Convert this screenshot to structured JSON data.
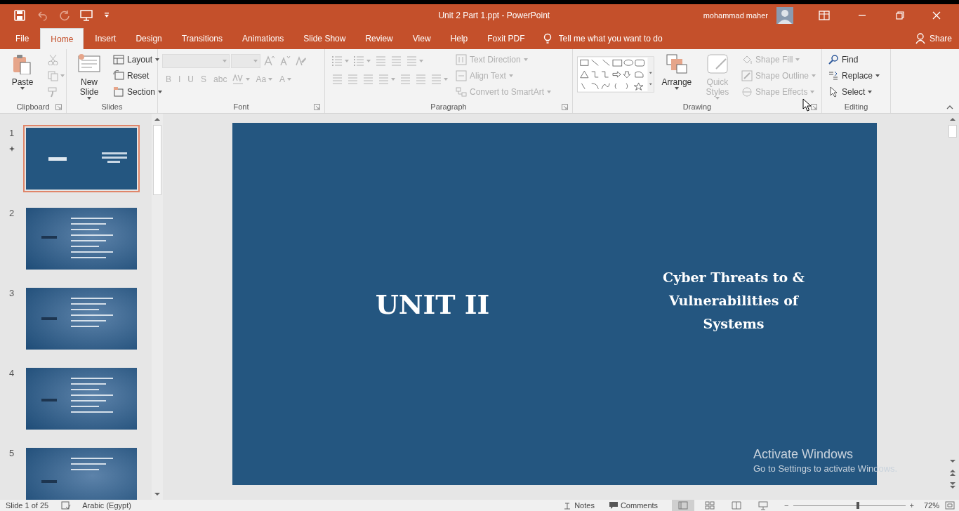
{
  "window": {
    "title": "Unit 2 Part 1.ppt - PowerPoint",
    "user": "mohammad maher"
  },
  "tabs": [
    {
      "label": "File",
      "selected": false
    },
    {
      "label": "Home",
      "selected": true
    },
    {
      "label": "Insert",
      "selected": false
    },
    {
      "label": "Design",
      "selected": false
    },
    {
      "label": "Transitions",
      "selected": false
    },
    {
      "label": "Animations",
      "selected": false
    },
    {
      "label": "Slide Show",
      "selected": false
    },
    {
      "label": "Review",
      "selected": false
    },
    {
      "label": "View",
      "selected": false
    },
    {
      "label": "Help",
      "selected": false
    },
    {
      "label": "Foxit PDF",
      "selected": false
    }
  ],
  "tell_me": {
    "placeholder": "Tell me what you want to do"
  },
  "share": {
    "label": "Share"
  },
  "ribbon": [
    {
      "label": "Clipboard",
      "launcher": true,
      "sections": [
        {
          "kind": "stack",
          "items": [
            {
              "kind": "large",
              "label": "Paste",
              "disabled": false,
              "menu": true
            }
          ]
        },
        {
          "kind": "stack",
          "items": [
            {
              "kind": "icon",
              "disabled": true,
              "menu": false
            },
            {
              "kind": "icon",
              "disabled": true,
              "menu": true
            },
            {
              "kind": "icon",
              "disabled": true,
              "menu": false
            }
          ]
        }
      ]
    },
    {
      "label": "Slides",
      "launcher": false,
      "sections": [
        {
          "kind": "stack",
          "items": [
            {
              "kind": "large",
              "label": "New Slide",
              "disabled": false,
              "menu": true
            }
          ]
        },
        {
          "kind": "stack",
          "items": [
            {
              "kind": "small",
              "label": "Layout",
              "disabled": false,
              "menu": true
            },
            {
              "kind": "small",
              "label": "Reset",
              "disabled": false,
              "menu": false
            },
            {
              "kind": "small",
              "label": "Section",
              "disabled": false,
              "menu": true
            }
          ]
        }
      ]
    },
    {
      "label": "Font",
      "launcher": true,
      "sections": [
        {
          "kind": "grid",
          "rows": [
            [
              {
                "kind": "font_field",
                "disabled": true
              },
              {
                "kind": "size_field",
                "disabled": true
              },
              {
                "kind": "icon",
                "disabled": true,
                "menu": false
              },
              {
                "kind": "icon",
                "disabled": true,
                "menu": false
              },
              {
                "kind": "icon",
                "disabled": true,
                "menu": false
              }
            ],
            [
              {
                "kind": "glyph",
                "label": "B",
                "disabled": true,
                "menu": false
              },
              {
                "kind": "glyph",
                "label": "I",
                "disabled": true,
                "menu": false
              },
              {
                "kind": "glyph",
                "label": "U",
                "disabled": true,
                "menu": false
              },
              {
                "kind": "glyph",
                "label": "S",
                "disabled": true,
                "menu": false
              },
              {
                "kind": "glyph",
                "label": "abc",
                "disabled": true,
                "menu": false
              },
              {
                "kind": "icon",
                "disabled": true,
                "menu": true
              },
              {
                "kind": "glyph",
                "label": "Aa",
                "disabled": true,
                "menu": true
              },
              {
                "kind": "glyph",
                "label": "A",
                "disabled": true,
                "menu": true
              }
            ]
          ]
        }
      ]
    },
    {
      "label": "Paragraph",
      "launcher": true,
      "sections": [
        {
          "kind": "grid",
          "rows": [
            [
              {
                "kind": "icon",
                "disabled": true,
                "menu": true
              },
              {
                "kind": "icon",
                "disabled": true,
                "menu": true
              },
              {
                "kind": "icon",
                "disabled": true,
                "menu": false
              },
              {
                "kind": "icon",
                "disabled": true,
                "menu": false
              },
              {
                "kind": "icon",
                "disabled": true,
                "menu": true
              }
            ],
            [
              {
                "kind": "icon",
                "disabled": true,
                "menu": false
              },
              {
                "kind": "icon",
                "disabled": true,
                "menu": false
              },
              {
                "kind": "icon",
                "disabled": true,
                "menu": false
              },
              {
                "kind": "icon",
                "disabled": true,
                "menu": true
              },
              {
                "kind": "icon",
                "disabled": true,
                "menu": false
              },
              {
                "kind": "icon",
                "disabled": true,
                "menu": false
              },
              {
                "kind": "icon",
                "disabled": true,
                "menu": true
              }
            ]
          ]
        },
        {
          "kind": "stack",
          "items": [
            {
              "kind": "small",
              "label": "Text Direction",
              "disabled": true,
              "menu": true
            },
            {
              "kind": "small",
              "label": "Align Text",
              "disabled": true,
              "menu": true
            },
            {
              "kind": "small",
              "label": "Convert to SmartArt",
              "disabled": true,
              "menu": true
            }
          ]
        }
      ]
    },
    {
      "label": "Drawing",
      "launcher": true,
      "sections": [
        {
          "kind": "gallery"
        },
        {
          "kind": "stack",
          "items": [
            {
              "kind": "large",
              "label": "Arrange",
              "disabled": false,
              "menu": true
            }
          ]
        },
        {
          "kind": "stack",
          "items": [
            {
              "kind": "large",
              "label": "Quick Styles",
              "disabled": true,
              "menu": true
            }
          ]
        },
        {
          "kind": "stack",
          "items": [
            {
              "kind": "small",
              "label": "Shape Fill",
              "disabled": true,
              "menu": true
            },
            {
              "kind": "small",
              "label": "Shape Outline",
              "disabled": true,
              "menu": true
            },
            {
              "kind": "small",
              "label": "Shape Effects",
              "disabled": true,
              "menu": true
            }
          ]
        }
      ]
    },
    {
      "label": "Editing",
      "launcher": false,
      "sections": [
        {
          "kind": "stack",
          "items": [
            {
              "kind": "small",
              "label": "Find",
              "disabled": false,
              "menu": false
            },
            {
              "kind": "small",
              "label": "Replace",
              "disabled": false,
              "menu": true
            },
            {
              "kind": "small",
              "label": "Select",
              "disabled": false,
              "menu": true
            }
          ]
        }
      ]
    }
  ],
  "slides": [
    {
      "number": "1",
      "selected": true,
      "animated": true,
      "kind": "title"
    },
    {
      "number": "2",
      "selected": false,
      "animated": false,
      "kind": "content"
    },
    {
      "number": "3",
      "selected": false,
      "animated": false,
      "kind": "content"
    },
    {
      "number": "4",
      "selected": false,
      "animated": false,
      "kind": "content"
    },
    {
      "number": "5",
      "selected": false,
      "animated": false,
      "kind": "content"
    }
  ],
  "slide": {
    "title": "UNIT II",
    "subtitle": "Cyber Threats to & Vulnerabilities of Systems"
  },
  "activation": {
    "title": "Activate Windows",
    "message": "Go to Settings to activate Windows."
  },
  "status_bar": {
    "slide_counter": "Slide 1 of 25",
    "language": "Arabic (Egypt)",
    "notes": "Notes",
    "comments": "Comments",
    "views": [
      {
        "selected": true
      },
      {
        "selected": false
      },
      {
        "selected": false
      },
      {
        "selected": false
      }
    ],
    "zoom": {
      "out": "−",
      "level": 0.58,
      "in": "+",
      "reading": "72%"
    }
  }
}
